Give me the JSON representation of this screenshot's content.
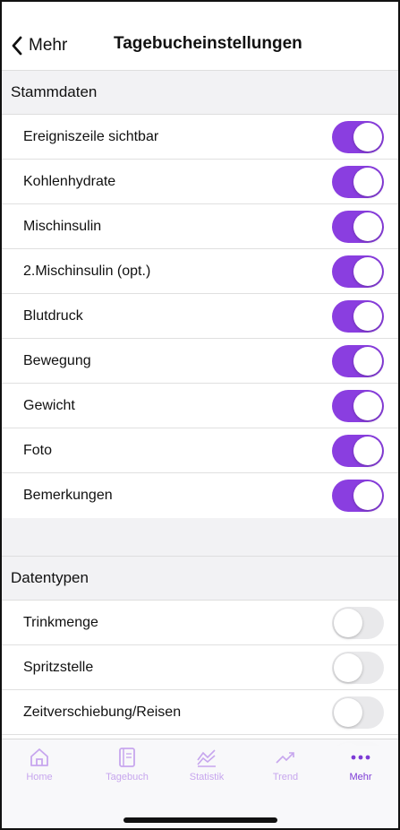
{
  "header": {
    "back_label": "Mehr",
    "title": "Tagebucheinstellungen"
  },
  "sections": [
    {
      "title": "Stammdaten",
      "rows": [
        {
          "label": "Ereigniszeile sichtbar",
          "enabled": true
        },
        {
          "label": "Kohlenhydrate",
          "enabled": true
        },
        {
          "label": "Mischinsulin",
          "enabled": true
        },
        {
          "label": "2.Mischinsulin (opt.)",
          "enabled": true
        },
        {
          "label": "Blutdruck",
          "enabled": true
        },
        {
          "label": "Bewegung",
          "enabled": true
        },
        {
          "label": "Gewicht",
          "enabled": true
        },
        {
          "label": "Foto",
          "enabled": true
        },
        {
          "label": "Bemerkungen",
          "enabled": true
        }
      ]
    },
    {
      "title": "Datentypen",
      "rows": [
        {
          "label": "Trinkmenge",
          "enabled": false
        },
        {
          "label": "Spritzstelle",
          "enabled": false
        },
        {
          "label": "Zeitverschiebung/Reisen",
          "enabled": false
        },
        {
          "label": "",
          "enabled": false
        }
      ]
    }
  ],
  "tabbar": {
    "tabs": [
      {
        "label": "Home",
        "icon": "home-icon",
        "active": false
      },
      {
        "label": "Tagebuch",
        "icon": "diary-icon",
        "active": false
      },
      {
        "label": "Statistik",
        "icon": "statistics-icon",
        "active": false
      },
      {
        "label": "Trend",
        "icon": "trend-icon",
        "active": false
      },
      {
        "label": "Mehr",
        "icon": "more-icon",
        "active": true
      }
    ]
  },
  "colors": {
    "accent": "#8a3ee0",
    "toggle_off": "#e9e9eb",
    "tab_inactive": "#c7a6ee",
    "tab_active": "#7d3bd6",
    "section_background": "#f2f2f4"
  }
}
